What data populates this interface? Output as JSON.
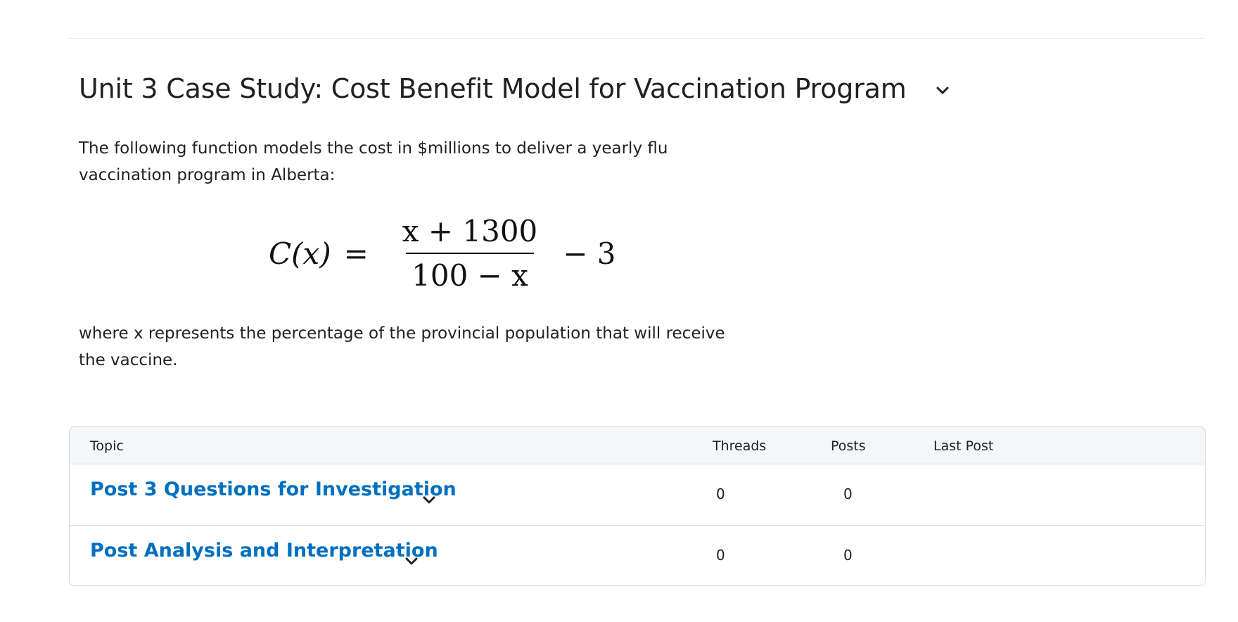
{
  "topic": {
    "title": "Unit 3 Case Study: Cost Benefit Model for Vaccination Program",
    "description_intro": "The following function models the cost in $millions to deliver a yearly flu vaccination program in Alberta:",
    "formula": {
      "lhs": "C(x)",
      "equals": "=",
      "numerator": "x + 1300",
      "denominator": "100 − x",
      "tail": "− 3"
    },
    "description_after": "where x represents the percentage of the provincial population that will receive the vaccine."
  },
  "table": {
    "headers": {
      "topic": "Topic",
      "threads": "Threads",
      "posts": "Posts",
      "last_post": "Last Post"
    },
    "rows": [
      {
        "topic": "Post 3 Questions for Investigation",
        "threads": "0",
        "posts": "0",
        "last_post": ""
      },
      {
        "topic": "Post Analysis and Interpretation",
        "threads": "0",
        "posts": "0",
        "last_post": ""
      }
    ]
  },
  "icons": {
    "title_menu": "chevron-down-icon",
    "row_menu": "chevron-down-icon"
  },
  "colors": {
    "link": "#006fbf",
    "text": "#202122",
    "header_bg": "#f5f6f8",
    "border": "#d8dadc"
  }
}
